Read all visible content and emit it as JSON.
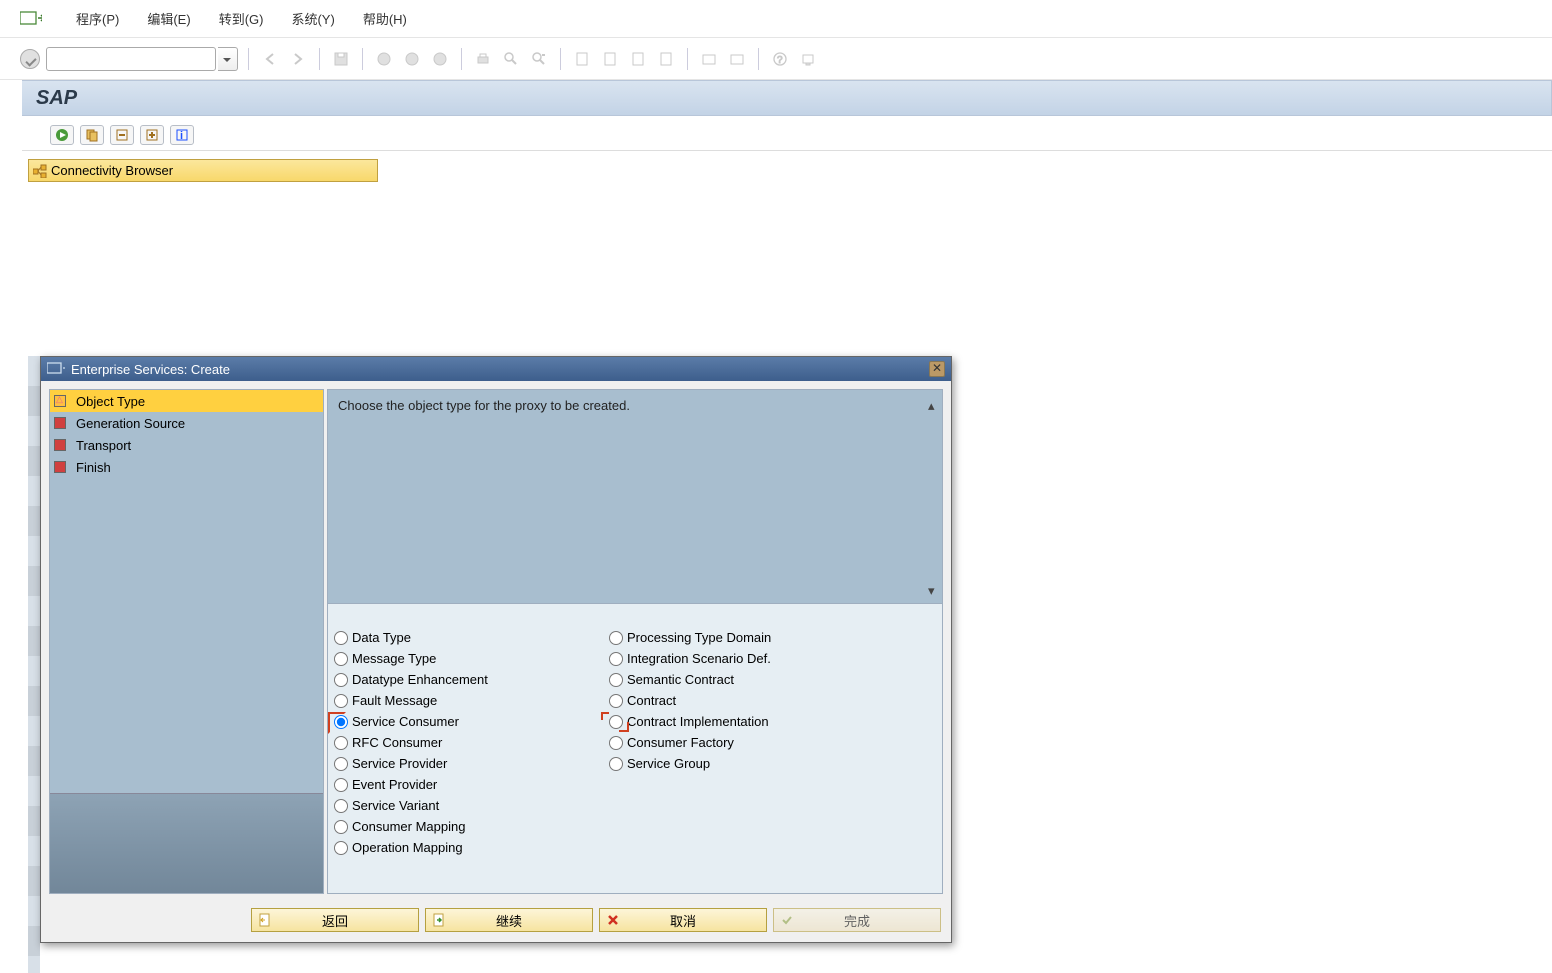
{
  "menu": {
    "program": "程序(P)",
    "edit": "编辑(E)",
    "goto": "转到(G)",
    "system": "系统(Y)",
    "help": "帮助(H)"
  },
  "title": "SAP",
  "conn_browser": "Connectivity Browser",
  "dialog": {
    "title": "Enterprise Services: Create",
    "instruction": "Choose the object type for the proxy to be created.",
    "steps": [
      {
        "label": "Object Type",
        "status": "warn",
        "active": true
      },
      {
        "label": "Generation Source",
        "status": "red"
      },
      {
        "label": "Transport",
        "status": "red"
      },
      {
        "label": "Finish",
        "status": "red"
      }
    ],
    "options_left": [
      "Data Type",
      "Message Type",
      "Datatype Enhancement",
      "Fault Message",
      "Service Consumer",
      "RFC Consumer",
      "Service Provider",
      "Event Provider",
      "Service Variant",
      "Consumer Mapping",
      "Operation Mapping"
    ],
    "options_right": [
      "Processing Type Domain",
      "Integration Scenario Def.",
      "Semantic Contract",
      "Contract",
      "Contract Implementation",
      "Consumer Factory",
      "Service Group"
    ],
    "selected": "Service Consumer",
    "buttons": {
      "back": "返回",
      "continue": "继续",
      "cancel": "取消",
      "finish": "完成"
    }
  }
}
